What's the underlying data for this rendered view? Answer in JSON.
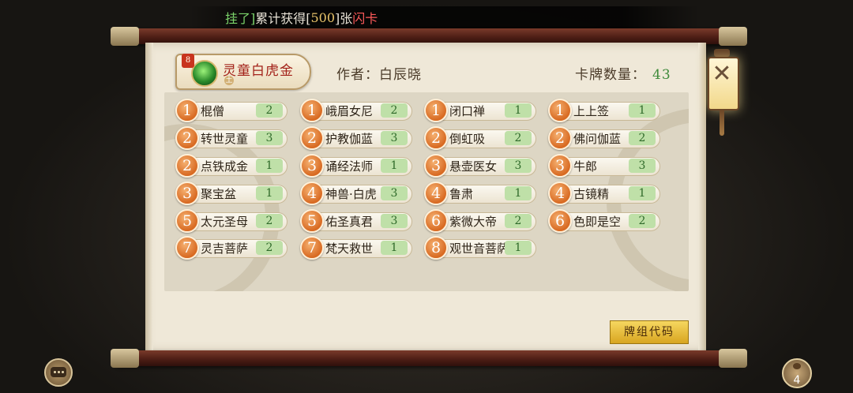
{
  "ticker": {
    "part1": "挂了]",
    "part2": "累计获得[",
    "part3": "500",
    "part4": "]张",
    "part5": "闪卡"
  },
  "hero": {
    "name": "灵童白虎金",
    "tag": "8",
    "sub": "土"
  },
  "author": "作者：白辰晓",
  "card_count_label": "卡牌数量：",
  "card_count": "43",
  "deck_code_button": "牌组代码",
  "close_icon_label": "✕",
  "bag_count": "4",
  "cards": [
    {
      "cost": "1",
      "name": "棍僧",
      "qty": "2"
    },
    {
      "cost": "1",
      "name": "峨眉女尼",
      "qty": "2"
    },
    {
      "cost": "1",
      "name": "闭口禅",
      "qty": "1"
    },
    {
      "cost": "1",
      "name": "上上签",
      "qty": "1"
    },
    {
      "cost": "2",
      "name": "转世灵童",
      "qty": "3"
    },
    {
      "cost": "2",
      "name": "护教伽蓝",
      "qty": "3"
    },
    {
      "cost": "2",
      "name": "倒虹吸",
      "qty": "2"
    },
    {
      "cost": "2",
      "name": "佛问伽蓝",
      "qty": "2"
    },
    {
      "cost": "2",
      "name": "点铁成金",
      "qty": "1"
    },
    {
      "cost": "3",
      "name": "诵经法师",
      "qty": "1"
    },
    {
      "cost": "3",
      "name": "悬壶医女",
      "qty": "3"
    },
    {
      "cost": "3",
      "name": "牛郎",
      "qty": "3"
    },
    {
      "cost": "3",
      "name": "聚宝盆",
      "qty": "1"
    },
    {
      "cost": "4",
      "name": "神兽·白虎",
      "qty": "3"
    },
    {
      "cost": "4",
      "name": "鲁肃",
      "qty": "1"
    },
    {
      "cost": "4",
      "name": "古镜精",
      "qty": "1"
    },
    {
      "cost": "5",
      "name": "太元圣母",
      "qty": "2"
    },
    {
      "cost": "5",
      "name": "佑圣真君",
      "qty": "3"
    },
    {
      "cost": "6",
      "name": "紫微大帝",
      "qty": "2"
    },
    {
      "cost": "6",
      "name": "色即是空",
      "qty": "2"
    },
    {
      "cost": "7",
      "name": "灵吉菩萨",
      "qty": "2"
    },
    {
      "cost": "7",
      "name": "梵天救世",
      "qty": "1"
    },
    {
      "cost": "8",
      "name": "观世音菩萨",
      "qty": "1"
    }
  ]
}
